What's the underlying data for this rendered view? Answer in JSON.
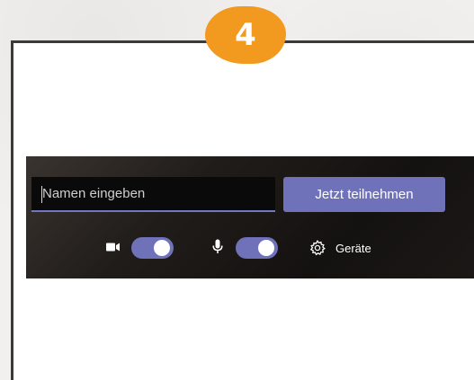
{
  "step": {
    "number": "4"
  },
  "join": {
    "name_placeholder": "Namen eingeben",
    "name_value": "",
    "join_label": "Jetzt teilnehmen"
  },
  "controls": {
    "camera": {
      "icon": "video-camera-icon",
      "toggle_on": true
    },
    "microphone": {
      "icon": "microphone-icon",
      "toggle_on": true
    },
    "devices": {
      "icon": "gear-icon",
      "label": "Geräte"
    }
  },
  "colors": {
    "accent": "#6f72b8",
    "badge": "#f29a1f",
    "bar_background": "#1a1715",
    "input_underline": "#7276c4"
  }
}
